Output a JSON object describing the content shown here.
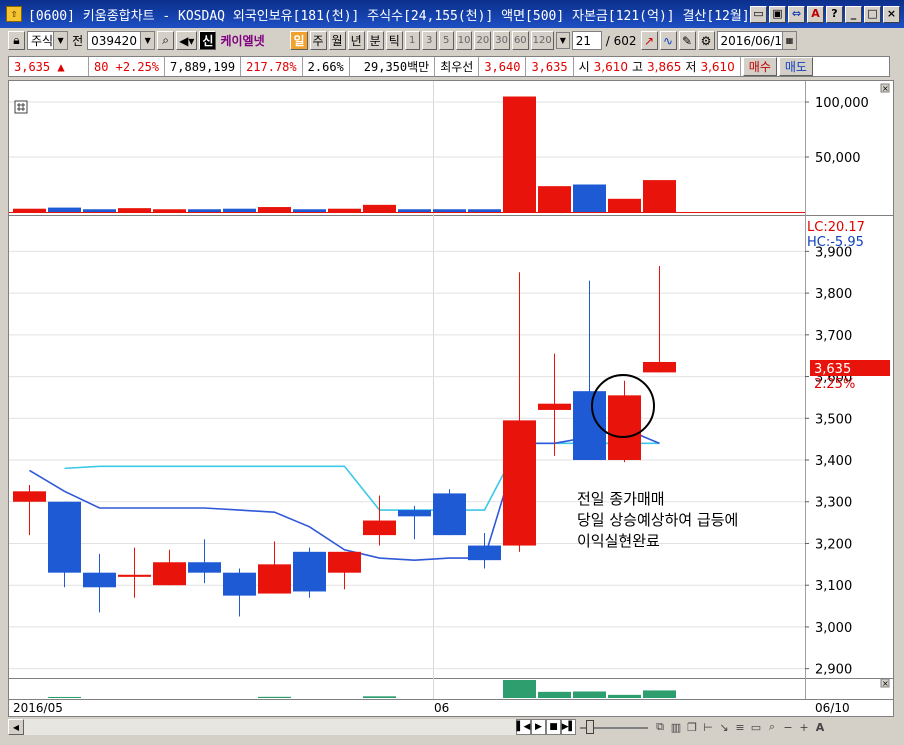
{
  "window": {
    "title": "[0600] 키움종합차트 - KOSDAQ 외국인보유[181(천)] 주식수[24,155(천)] 액면[500] 자본금[121(억)] 결산[12월]"
  },
  "toolbar": {
    "market_label": "주식",
    "prev_label": "전",
    "code_value": "039420",
    "stock_name": "케이엘넷",
    "period_active": "일",
    "periods": [
      "주",
      "월",
      "년",
      "분",
      "틱"
    ],
    "intervals": [
      "1",
      "3",
      "5",
      "10",
      "20",
      "30",
      "60",
      "120"
    ],
    "count_value": "21",
    "total_count": "/ 602",
    "date_value": "2016/06/1"
  },
  "quote": {
    "price": "3,635 ▲",
    "change": "80 +2.25%",
    "volume": "7,889,199",
    "volume_ratio": "217.78%",
    "turnover": "2.66%",
    "amount": "29,350백만",
    "best_label": "최우선",
    "best_ask": "3,640",
    "best_bid": "3,635",
    "open_label": "시",
    "open": "3,610",
    "high_label": "고",
    "high": "3,865",
    "low_label": "저",
    "low": "3,610",
    "buy_label": "매수",
    "sell_label": "매도"
  },
  "chart_data": {
    "type": "candlestick",
    "date_labels": [
      "2016/05",
      "06",
      "06/10"
    ],
    "candles": [
      {
        "open": 3300,
        "high": 3340,
        "low": 3220,
        "close": 3325
      },
      {
        "open": 3300,
        "high": 3300,
        "low": 3095,
        "close": 3130
      },
      {
        "open": 3130,
        "high": 3175,
        "low": 3035,
        "close": 3095
      },
      {
        "open": 3120,
        "high": 3190,
        "low": 3070,
        "close": 3125
      },
      {
        "open": 3100,
        "high": 3185,
        "low": 3100,
        "close": 3155
      },
      {
        "open": 3155,
        "high": 3210,
        "low": 3105,
        "close": 3130
      },
      {
        "open": 3130,
        "high": 3140,
        "low": 3025,
        "close": 3075
      },
      {
        "open": 3080,
        "high": 3205,
        "low": 3080,
        "close": 3150
      },
      {
        "open": 3180,
        "high": 3190,
        "low": 3070,
        "close": 3085
      },
      {
        "open": 3130,
        "high": 3180,
        "low": 3090,
        "close": 3180
      },
      {
        "open": 3220,
        "high": 3315,
        "low": 3195,
        "close": 3255
      },
      {
        "open": 3280,
        "high": 3290,
        "low": 3210,
        "close": 3265
      },
      {
        "open": 3320,
        "high": 3330,
        "low": 3220,
        "close": 3220
      },
      {
        "open": 3195,
        "high": 3225,
        "low": 3140,
        "close": 3160
      },
      {
        "open": 3195,
        "high": 3850,
        "low": 3180,
        "close": 3495
      },
      {
        "open": 3520,
        "high": 3655,
        "low": 3410,
        "close": 3535
      },
      {
        "open": 3565,
        "high": 3830,
        "low": 3400,
        "close": 3400
      },
      {
        "open": 3400,
        "high": 3590,
        "low": 3395,
        "close": 3555
      },
      {
        "open": 3610,
        "high": 3865,
        "low": 3610,
        "close": 3635
      }
    ],
    "upper_band": [
      null,
      3380,
      3385,
      3385,
      3385,
      3385,
      3385,
      3385,
      3385,
      3385,
      3280,
      3280,
      3280,
      3280,
      3440,
      3440,
      3440,
      3440,
      3440
    ],
    "lower_band": [
      3375,
      3325,
      3285,
      3285,
      3285,
      3285,
      3280,
      3275,
      3240,
      3185,
      3165,
      3160,
      3165,
      3165,
      3440,
      3440,
      3455,
      3475,
      3440
    ],
    "volume": [
      3000,
      4000,
      2500,
      3500,
      2500,
      2500,
      3000,
      4500,
      2500,
      3000,
      6500,
      2500,
      2500,
      2500,
      105000,
      23500,
      25000,
      12000,
      29000
    ],
    "volume_up": [
      true,
      false,
      false,
      true,
      true,
      false,
      false,
      true,
      false,
      true,
      true,
      false,
      false,
      false,
      true,
      true,
      false,
      true,
      true
    ],
    "volume_axis_ticks": [
      "50,000",
      "100,000"
    ],
    "price_axis_ticks": [
      "2,900",
      "3,000",
      "3,100",
      "3,200",
      "3,300",
      "3,400",
      "3,500",
      "3,600",
      "3,700",
      "3,800",
      "3,900"
    ],
    "ylim": [
      2880,
      3980
    ],
    "lc_label": "LC:20.17",
    "hc_label": "HC:-5.95",
    "price_tag": "3,635",
    "pct_tag": "2.25%",
    "annotation": [
      "전일 종가매매",
      "당일 상승예상하여 급등에",
      "이익실현완료"
    ]
  },
  "colors": {
    "up": "#e8140c",
    "down": "#1e5ad4",
    "upper_band": "#3cc8e8",
    "lower_band": "#2f58d8",
    "lower_strip_up": "#2f9e6e"
  }
}
